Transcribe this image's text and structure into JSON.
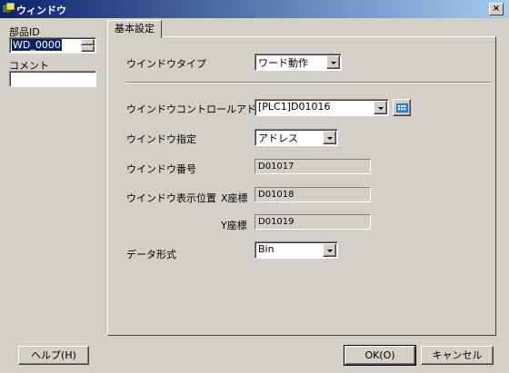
{
  "window": {
    "title": "ウィンドウ",
    "close_glyph": "×"
  },
  "left": {
    "part_id_label": "部品ID",
    "part_id_value": "WD_0000",
    "comment_label": "コメント",
    "comment_value": ""
  },
  "tab": {
    "label": "基本設定"
  },
  "form": {
    "window_type_label": "ウインドウタイプ",
    "window_type_value": "ワード動作",
    "control_address_label": "ウインドウコントロールアドレス",
    "control_address_value": "[PLC1]D01016",
    "window_spec_label": "ウインドウ指定",
    "window_spec_value": "アドレス",
    "window_number_label": "ウインドウ番号",
    "window_number_value": "D01017",
    "display_pos_label": "ウインドウ表示位置",
    "x_label": "X座標",
    "x_value": "D01018",
    "y_label": "Y座標",
    "y_value": "D01019",
    "data_format_label": "データ形式",
    "data_format_value": "Bin"
  },
  "buttons": {
    "help": "ヘルプ(H)",
    "ok": "OK(O)",
    "cancel": "キャンセル"
  },
  "colors": {
    "titlebar_start": "#0a246a",
    "titlebar_end": "#a6caf0",
    "face": "#d4d0c8"
  }
}
